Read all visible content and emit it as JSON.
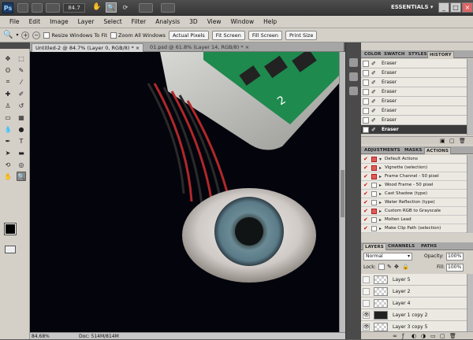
{
  "appbar": {
    "logo": "Ps",
    "zoom": "84.7",
    "workspace": "ESSENTIALS ▾",
    "window_buttons": [
      "_",
      "□",
      "×"
    ]
  },
  "menu": [
    "File",
    "Edit",
    "Image",
    "Layer",
    "Select",
    "Filter",
    "Analysis",
    "3D",
    "View",
    "Window",
    "Help"
  ],
  "options": {
    "resize_windows": "Resize Windows To Fit",
    "zoom_all": "Zoom All Windows",
    "actual_pixels": "Actual Pixels",
    "fit_screen": "Fit Screen",
    "fill_screen": "Fill Screen",
    "print_size": "Print Size"
  },
  "tabs": [
    {
      "label": "Untitled-2 @ 84.7% (Layer 0, RGB/8) *  ×"
    },
    {
      "label": "01.psd @ 61.8% (Layer 14, RGB/8) *  ×"
    }
  ],
  "status": {
    "zoom": "84.68%",
    "doc": "Doc: 514M/814M"
  },
  "history": {
    "tabs": [
      "COLOR",
      "SWATCH",
      "STYLES",
      "HISTORY"
    ],
    "items": [
      "Eraser",
      "Eraser",
      "Eraser",
      "Eraser",
      "Eraser",
      "Eraser",
      "Eraser",
      "Eraser"
    ]
  },
  "actions": {
    "tabs": [
      "ADJUSTMENTS",
      "MASKS",
      "ACTIONS"
    ],
    "items": [
      "Default Actions",
      "Vignette (selection)",
      "Frame Channel - 50 pixel",
      "Wood Frame - 50 pixel",
      "Cast Shadow (type)",
      "Water Reflection (type)",
      "Custom RGB to Grayscale",
      "Molten Lead",
      "Make Clip Path (selection)"
    ]
  },
  "layers": {
    "tabs": [
      "LAYERS",
      "CHANNELS",
      "PATHS"
    ],
    "blend_mode": "Normal",
    "opacity_label": "Opacity:",
    "opacity": "100%",
    "lock_label": "Lock:",
    "fill_label": "Fill:",
    "fill": "100%",
    "items": [
      "Layer 5",
      "Layer 2",
      "Layer 4",
      "Layer 1 copy 2",
      "Layer 3 copy 5"
    ]
  },
  "colors": {
    "accent": "#3a3a3a",
    "panel": "#d4d0c8",
    "iris": "#5e7f8c"
  }
}
